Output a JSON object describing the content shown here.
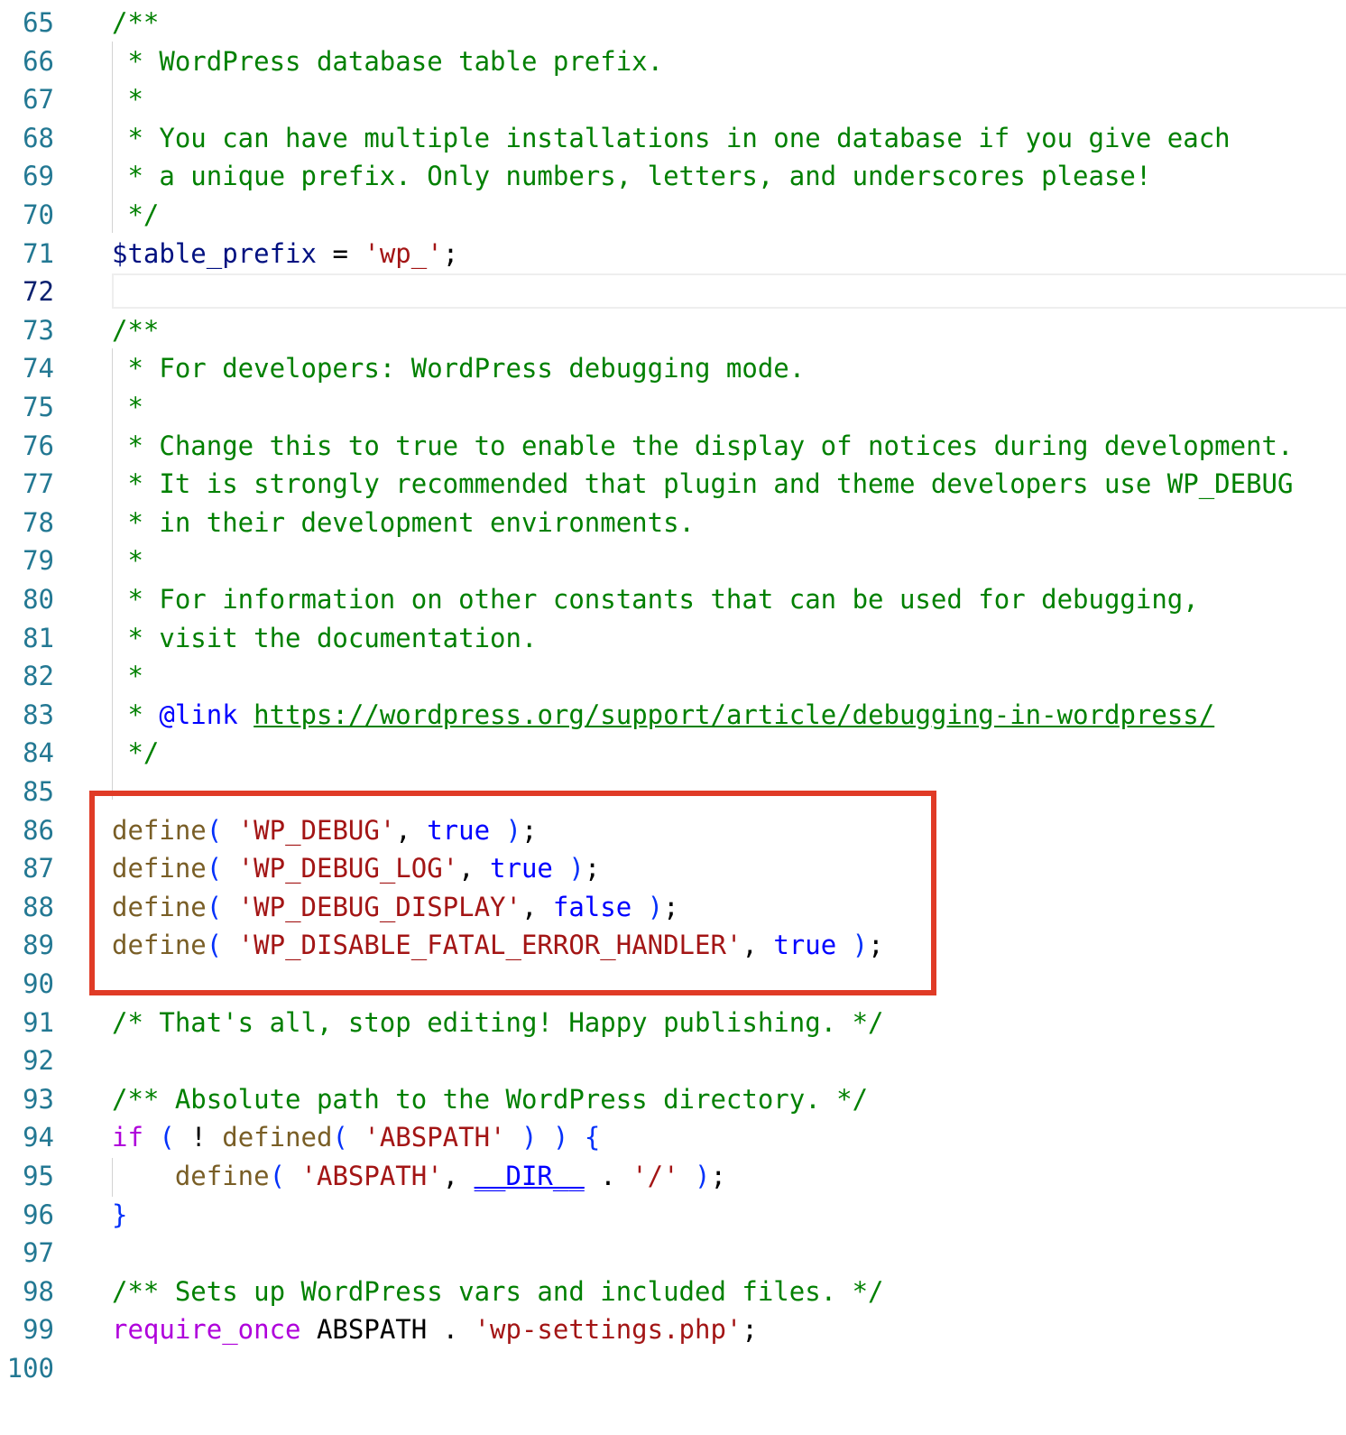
{
  "editor": {
    "lines": [
      {
        "num": "65",
        "tokens": [
          {
            "t": "/**",
            "c": "comment"
          }
        ]
      },
      {
        "num": "66",
        "tokens": [
          {
            "t": " * WordPress database table prefix.",
            "c": "comment"
          }
        ]
      },
      {
        "num": "67",
        "tokens": [
          {
            "t": " *",
            "c": "comment"
          }
        ]
      },
      {
        "num": "68",
        "tokens": [
          {
            "t": " * You can have multiple installations in one database if you give each",
            "c": "comment"
          }
        ]
      },
      {
        "num": "69",
        "tokens": [
          {
            "t": " * a unique prefix. Only numbers, letters, and underscores please!",
            "c": "comment"
          }
        ]
      },
      {
        "num": "70",
        "tokens": [
          {
            "t": " */",
            "c": "comment"
          }
        ]
      },
      {
        "num": "71",
        "tokens": [
          {
            "t": "$table_prefix",
            "c": "var"
          },
          {
            "t": " = ",
            "c": "plain"
          },
          {
            "t": "'wp_'",
            "c": "str"
          },
          {
            "t": ";",
            "c": "plain"
          }
        ]
      },
      {
        "num": "72",
        "tokens": [],
        "active": true
      },
      {
        "num": "73",
        "tokens": [
          {
            "t": "/**",
            "c": "comment"
          }
        ]
      },
      {
        "num": "74",
        "tokens": [
          {
            "t": " * For developers: WordPress debugging mode.",
            "c": "comment"
          }
        ]
      },
      {
        "num": "75",
        "tokens": [
          {
            "t": " *",
            "c": "comment"
          }
        ]
      },
      {
        "num": "76",
        "tokens": [
          {
            "t": " * Change this to true to enable the display of notices during development.",
            "c": "comment"
          }
        ]
      },
      {
        "num": "77",
        "tokens": [
          {
            "t": " * It is strongly recommended that plugin and theme developers use WP_DEBUG",
            "c": "comment"
          }
        ]
      },
      {
        "num": "78",
        "tokens": [
          {
            "t": " * in their development environments.",
            "c": "comment"
          }
        ]
      },
      {
        "num": "79",
        "tokens": [
          {
            "t": " *",
            "c": "comment"
          }
        ]
      },
      {
        "num": "80",
        "tokens": [
          {
            "t": " * For information on other constants that can be used for debugging,",
            "c": "comment"
          }
        ]
      },
      {
        "num": "81",
        "tokens": [
          {
            "t": " * visit the documentation.",
            "c": "comment"
          }
        ]
      },
      {
        "num": "82",
        "tokens": [
          {
            "t": " *",
            "c": "comment"
          }
        ]
      },
      {
        "num": "83",
        "tokens": [
          {
            "t": " * ",
            "c": "comment"
          },
          {
            "t": "@link",
            "c": "tag"
          },
          {
            "t": " ",
            "c": "comment"
          },
          {
            "t": "https://wordpress.org/support/article/debugging-in-wordpress/",
            "c": "link"
          }
        ]
      },
      {
        "num": "84",
        "tokens": [
          {
            "t": " */",
            "c": "comment"
          }
        ]
      },
      {
        "num": "85",
        "tokens": []
      },
      {
        "num": "86",
        "tokens": [
          {
            "t": "define",
            "c": "fn"
          },
          {
            "t": "( ",
            "c": "brk"
          },
          {
            "t": "'WP_DEBUG'",
            "c": "str"
          },
          {
            "t": ", ",
            "c": "plain"
          },
          {
            "t": "true",
            "c": "kw"
          },
          {
            "t": " )",
            "c": "brk"
          },
          {
            "t": ";",
            "c": "plain"
          }
        ]
      },
      {
        "num": "87",
        "tokens": [
          {
            "t": "define",
            "c": "fn"
          },
          {
            "t": "( ",
            "c": "brk"
          },
          {
            "t": "'WP_DEBUG_LOG'",
            "c": "str"
          },
          {
            "t": ", ",
            "c": "plain"
          },
          {
            "t": "true",
            "c": "kw"
          },
          {
            "t": " )",
            "c": "brk"
          },
          {
            "t": ";",
            "c": "plain"
          }
        ]
      },
      {
        "num": "88",
        "tokens": [
          {
            "t": "define",
            "c": "fn"
          },
          {
            "t": "( ",
            "c": "brk"
          },
          {
            "t": "'WP_DEBUG_DISPLAY'",
            "c": "str"
          },
          {
            "t": ", ",
            "c": "plain"
          },
          {
            "t": "false",
            "c": "kw"
          },
          {
            "t": " )",
            "c": "brk"
          },
          {
            "t": ";",
            "c": "plain"
          }
        ]
      },
      {
        "num": "89",
        "tokens": [
          {
            "t": "define",
            "c": "fn"
          },
          {
            "t": "( ",
            "c": "brk"
          },
          {
            "t": "'WP_DISABLE_FATAL_ERROR_HANDLER'",
            "c": "str"
          },
          {
            "t": ", ",
            "c": "plain"
          },
          {
            "t": "true",
            "c": "kw"
          },
          {
            "t": " )",
            "c": "brk"
          },
          {
            "t": ";",
            "c": "plain"
          }
        ]
      },
      {
        "num": "90",
        "tokens": []
      },
      {
        "num": "91",
        "tokens": [
          {
            "t": "/* That's all, stop editing! Happy publishing. */",
            "c": "comment"
          }
        ]
      },
      {
        "num": "92",
        "tokens": []
      },
      {
        "num": "93",
        "tokens": [
          {
            "t": "/** Absolute path to the WordPress directory. */",
            "c": "comment"
          }
        ]
      },
      {
        "num": "94",
        "tokens": [
          {
            "t": "if",
            "c": "ctrl"
          },
          {
            "t": " ( ",
            "c": "brk"
          },
          {
            "t": "! ",
            "c": "plain"
          },
          {
            "t": "defined",
            "c": "fn"
          },
          {
            "t": "( ",
            "c": "brk"
          },
          {
            "t": "'ABSPATH'",
            "c": "str"
          },
          {
            "t": " ) ) {",
            "c": "brk"
          }
        ]
      },
      {
        "num": "95",
        "tokens": [
          {
            "t": "    ",
            "c": "plain"
          },
          {
            "t": "define",
            "c": "fn"
          },
          {
            "t": "( ",
            "c": "brk"
          },
          {
            "t": "'ABSPATH'",
            "c": "str"
          },
          {
            "t": ", ",
            "c": "plain"
          },
          {
            "t": "__DIR__",
            "c": "const"
          },
          {
            "t": " . ",
            "c": "plain"
          },
          {
            "t": "'/'",
            "c": "str"
          },
          {
            "t": " )",
            "c": "brk"
          },
          {
            "t": ";",
            "c": "plain"
          }
        ]
      },
      {
        "num": "96",
        "tokens": [
          {
            "t": "}",
            "c": "brk"
          }
        ]
      },
      {
        "num": "97",
        "tokens": []
      },
      {
        "num": "98",
        "tokens": [
          {
            "t": "/** Sets up WordPress vars and included files. */",
            "c": "comment"
          }
        ]
      },
      {
        "num": "99",
        "tokens": [
          {
            "t": "require_once",
            "c": "ctrl"
          },
          {
            "t": " ABSPATH . ",
            "c": "plain"
          },
          {
            "t": "'wp-settings.php'",
            "c": "str"
          },
          {
            "t": ";",
            "c": "plain"
          }
        ]
      },
      {
        "num": "100",
        "tokens": []
      }
    ]
  },
  "colors": {
    "highlight_box": "#e03b26",
    "line_number": "#237893",
    "comment": "#008000",
    "string": "#a31515",
    "keyword": "#0000ff",
    "function": "#795e26"
  }
}
